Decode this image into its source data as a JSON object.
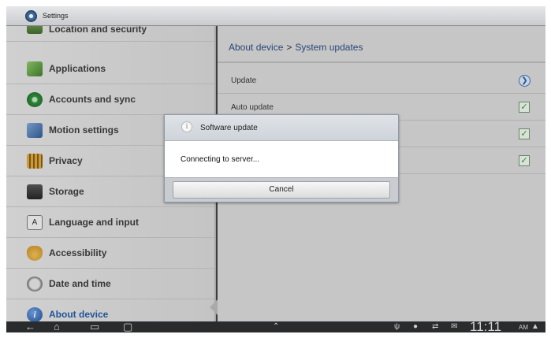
{
  "titlebar": {
    "title": "Settings",
    "icon": "settings-icon"
  },
  "sidebar": {
    "items": [
      {
        "label": "Location and security",
        "icon": "location-security-icon",
        "color": "#4f7d3a"
      },
      {
        "label": "Applications",
        "icon": "applications-icon",
        "color": "#5a9b3f"
      },
      {
        "label": "Accounts and sync",
        "icon": "sync-icon",
        "color": "#2f8f3a"
      },
      {
        "label": "Motion settings",
        "icon": "motion-icon",
        "color": "#3f6ea8"
      },
      {
        "label": "Privacy",
        "icon": "privacy-icon",
        "color": "#d0a030"
      },
      {
        "label": "Storage",
        "icon": "storage-icon",
        "color": "#3b3b3b"
      },
      {
        "label": "Language and input",
        "icon": "language-icon",
        "color": "#ececec"
      },
      {
        "label": "Accessibility",
        "icon": "accessibility-icon",
        "color": "#d79a2a"
      },
      {
        "label": "Date and time",
        "icon": "clock-icon",
        "color": "#9a9a9a"
      },
      {
        "label": "About device",
        "icon": "info-icon",
        "color": "#2d66b5",
        "active": true
      }
    ]
  },
  "main": {
    "breadcrumb": {
      "parent": "About device",
      "separator": ">",
      "current": "System updates"
    },
    "rows": [
      {
        "label": "Update",
        "control": "chevron-right"
      },
      {
        "label": "Auto update",
        "control": "checkbox",
        "checked": true
      },
      {
        "label": "",
        "control": "checkbox",
        "checked": true
      },
      {
        "label": "",
        "control": "checkbox",
        "checked": true
      }
    ]
  },
  "dialog": {
    "title": "Software update",
    "message": "Connecting to server...",
    "cancel_label": "Cancel"
  },
  "statusbar": {
    "time": "11:11",
    "ampm": "AM"
  }
}
